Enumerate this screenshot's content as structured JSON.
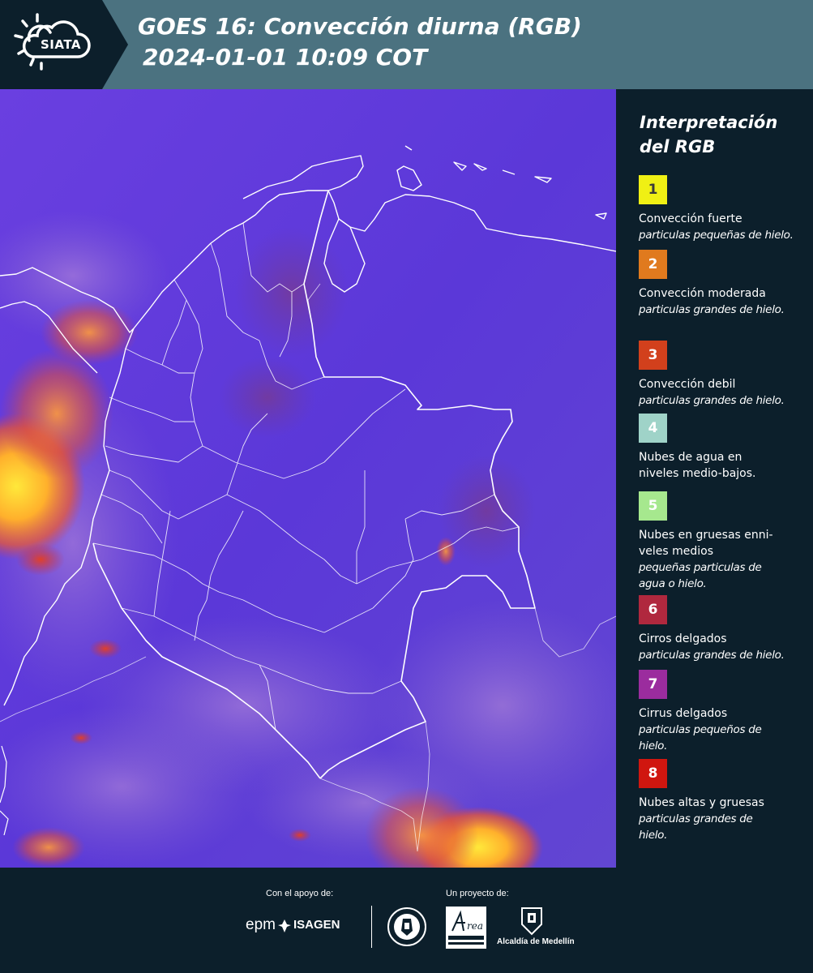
{
  "header": {
    "logo_text": "SIATA",
    "title_line1": "GOES 16: Convección diurna (RGB)",
    "title_line2": "2024-01-01 10:09 COT"
  },
  "legend": {
    "title": "Interpretación del RGB",
    "items": [
      {
        "number": "1",
        "label": "Convección fuerte",
        "detail": "particulas pequeñas de hielo.",
        "color": "#f0f014",
        "number_color": "#3a3a3a"
      },
      {
        "number": "2",
        "label": "Convección moderada",
        "detail": "particulas grandes de hielo.",
        "color": "#e07a1e",
        "number_color": "#ffffff"
      },
      {
        "number": "3",
        "label": "Convección debil",
        "detail": "particulas grandes de hielo.",
        "color": "#d2401c",
        "number_color": "#ffffff"
      },
      {
        "number": "4",
        "label": "Nubes de agua en niveles medio-bajos.",
        "detail": "",
        "color": "#9fd3c8",
        "number_color": "#ffffff"
      },
      {
        "number": "5",
        "label": "Nubes en gruesas enni-veles medios",
        "detail": "pequeñas particulas de agua o hielo.",
        "color": "#a6e88e",
        "number_color": "#ffffff"
      },
      {
        "number": "6",
        "label": "Cirros delgados",
        "detail": "particulas grandes de hielo.",
        "color": "#b0283e",
        "number_color": "#ffffff"
      },
      {
        "number": "7",
        "label": "Cirrus delgados",
        "detail": "particulas pequeños de hielo.",
        "color": "#9b2c9e",
        "number_color": "#ffffff"
      },
      {
        "number": "8",
        "label": "Nubes altas y gruesas",
        "detail": "particulas grandes de hielo.",
        "color": "#d0160f",
        "number_color": "#ffffff"
      }
    ]
  },
  "footer": {
    "support_label": "Con el apoyo de:",
    "project_label": "Un proyecto de:",
    "sponsor_1": "epm",
    "sponsor_2": "ISAGEN",
    "partner_label": "Alcaldía de Medellín",
    "area_logo_lettering": "Área Metropolitana Valle de Aburrá"
  }
}
